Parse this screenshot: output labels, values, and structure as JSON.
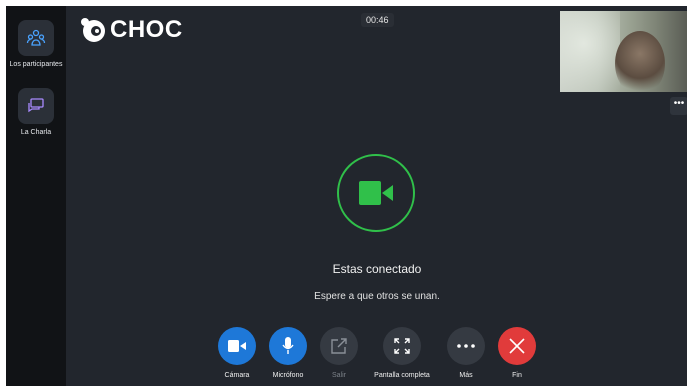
{
  "app": {
    "logo_text": "CHOC",
    "timer": "00:46"
  },
  "sidebar": {
    "items": [
      {
        "label": "Los participantes",
        "icon": "participants-icon"
      },
      {
        "label": "La Charla",
        "icon": "chat-icon"
      }
    ]
  },
  "main": {
    "status_title": "Estas conectado",
    "status_hint": "Espere a que otros se unan.",
    "more_corner": "•••"
  },
  "controls": [
    {
      "label": "Cámara",
      "icon": "video-camera-icon",
      "color": "#1e78d8"
    },
    {
      "label": "Micrófono",
      "icon": "microphone-icon",
      "color": "#1e78d8"
    },
    {
      "label": "Salir",
      "icon": "share-out-icon",
      "color": "#353a42",
      "disabled": true
    },
    {
      "label": "Pantalla completa",
      "icon": "fullscreen-icon",
      "color": "#353a42"
    },
    {
      "label": "Más",
      "icon": "more-icon",
      "color": "#353a42"
    },
    {
      "label": "Fin",
      "icon": "end-call-icon",
      "color": "#e13b3b"
    }
  ],
  "colors": {
    "accent_green": "#30c04a",
    "background": "#22262d",
    "sidebar": "#111316"
  }
}
